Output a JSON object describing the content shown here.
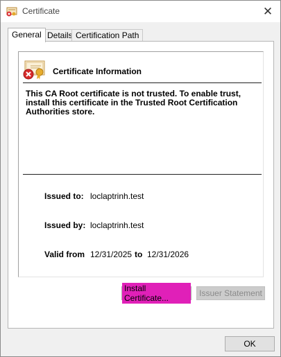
{
  "window": {
    "title": "Certificate",
    "close_glyph": "✕"
  },
  "tabs": [
    {
      "label": "General",
      "active": true
    },
    {
      "label": "Details",
      "active": false
    },
    {
      "label": "Certification Path",
      "active": false
    }
  ],
  "general": {
    "info_title": "Certificate Information",
    "warning": "This CA Root certificate is not trusted. To enable trust, install this certificate in the Trusted Root Certification Authorities store.",
    "issued_to_label": "Issued to:",
    "issued_to_value": "loclaptrinh.test",
    "issued_by_label": "Issued by:",
    "issued_by_value": "loclaptrinh.test",
    "valid_from_label": "Valid from",
    "valid_from_value": "12/31/2025",
    "valid_to_label": "to",
    "valid_to_value": "12/31/2026"
  },
  "buttons": {
    "install": "Install Certificate...",
    "issuer": "Issuer Statement",
    "ok": "OK"
  },
  "colors": {
    "highlight": "#e020b8",
    "disabled_text": "#8a8a8a"
  },
  "icons": {
    "title": "certificate-icon",
    "info": "certificate-untrusted-icon"
  }
}
